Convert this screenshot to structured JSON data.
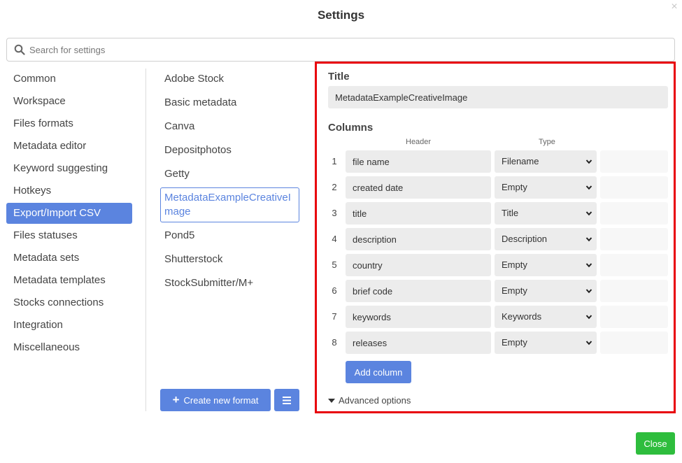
{
  "dialog": {
    "title": "Settings",
    "close_icon": "×"
  },
  "search": {
    "placeholder": "Search for settings",
    "value": ""
  },
  "nav": {
    "items": [
      {
        "label": "Common"
      },
      {
        "label": "Workspace"
      },
      {
        "label": "Files formats"
      },
      {
        "label": "Metadata editor"
      },
      {
        "label": "Keyword suggesting"
      },
      {
        "label": "Hotkeys"
      },
      {
        "label": "Export/Import CSV",
        "active": true
      },
      {
        "label": "Files statuses"
      },
      {
        "label": "Metadata sets"
      },
      {
        "label": "Metadata templates"
      },
      {
        "label": "Stocks connections"
      },
      {
        "label": "Integration"
      },
      {
        "label": "Miscellaneous"
      }
    ]
  },
  "formats": {
    "items": [
      {
        "label": "Adobe Stock"
      },
      {
        "label": "Basic metadata"
      },
      {
        "label": "Canva"
      },
      {
        "label": "Depositphotos"
      },
      {
        "label": "Getty"
      },
      {
        "label": "MetadataExampleCreativeImage",
        "active": true
      },
      {
        "label": "Pond5"
      },
      {
        "label": "Shutterstock"
      },
      {
        "label": "StockSubmitter/M+"
      }
    ],
    "create_label": "Create new format"
  },
  "editor": {
    "title_label": "Title",
    "title_value": "MetadataExampleCreativeImage",
    "columns_label": "Columns",
    "header_col": "Header",
    "type_col": "Type",
    "rows": [
      {
        "num": "1",
        "header": "file name",
        "type": "Filename"
      },
      {
        "num": "2",
        "header": "created date",
        "type": "Empty"
      },
      {
        "num": "3",
        "header": "title",
        "type": "Title"
      },
      {
        "num": "4",
        "header": "description",
        "type": "Description"
      },
      {
        "num": "5",
        "header": "country",
        "type": "Empty"
      },
      {
        "num": "6",
        "header": "brief code",
        "type": "Empty"
      },
      {
        "num": "7",
        "header": "keywords",
        "type": "Keywords"
      },
      {
        "num": "8",
        "header": "releases",
        "type": "Empty"
      }
    ],
    "add_column_label": "Add column",
    "advanced_label": "Advanced options"
  },
  "footer": {
    "close_label": "Close"
  },
  "colors": {
    "accent": "#5b84df",
    "close_button": "#2ebd3d",
    "highlight_border": "#e8000b"
  },
  "icons": {
    "search": "search-icon",
    "plus": "plus-icon",
    "menu": "hamburger-icon",
    "chevron": "chevron-down-icon",
    "caret": "caret-down-icon"
  }
}
